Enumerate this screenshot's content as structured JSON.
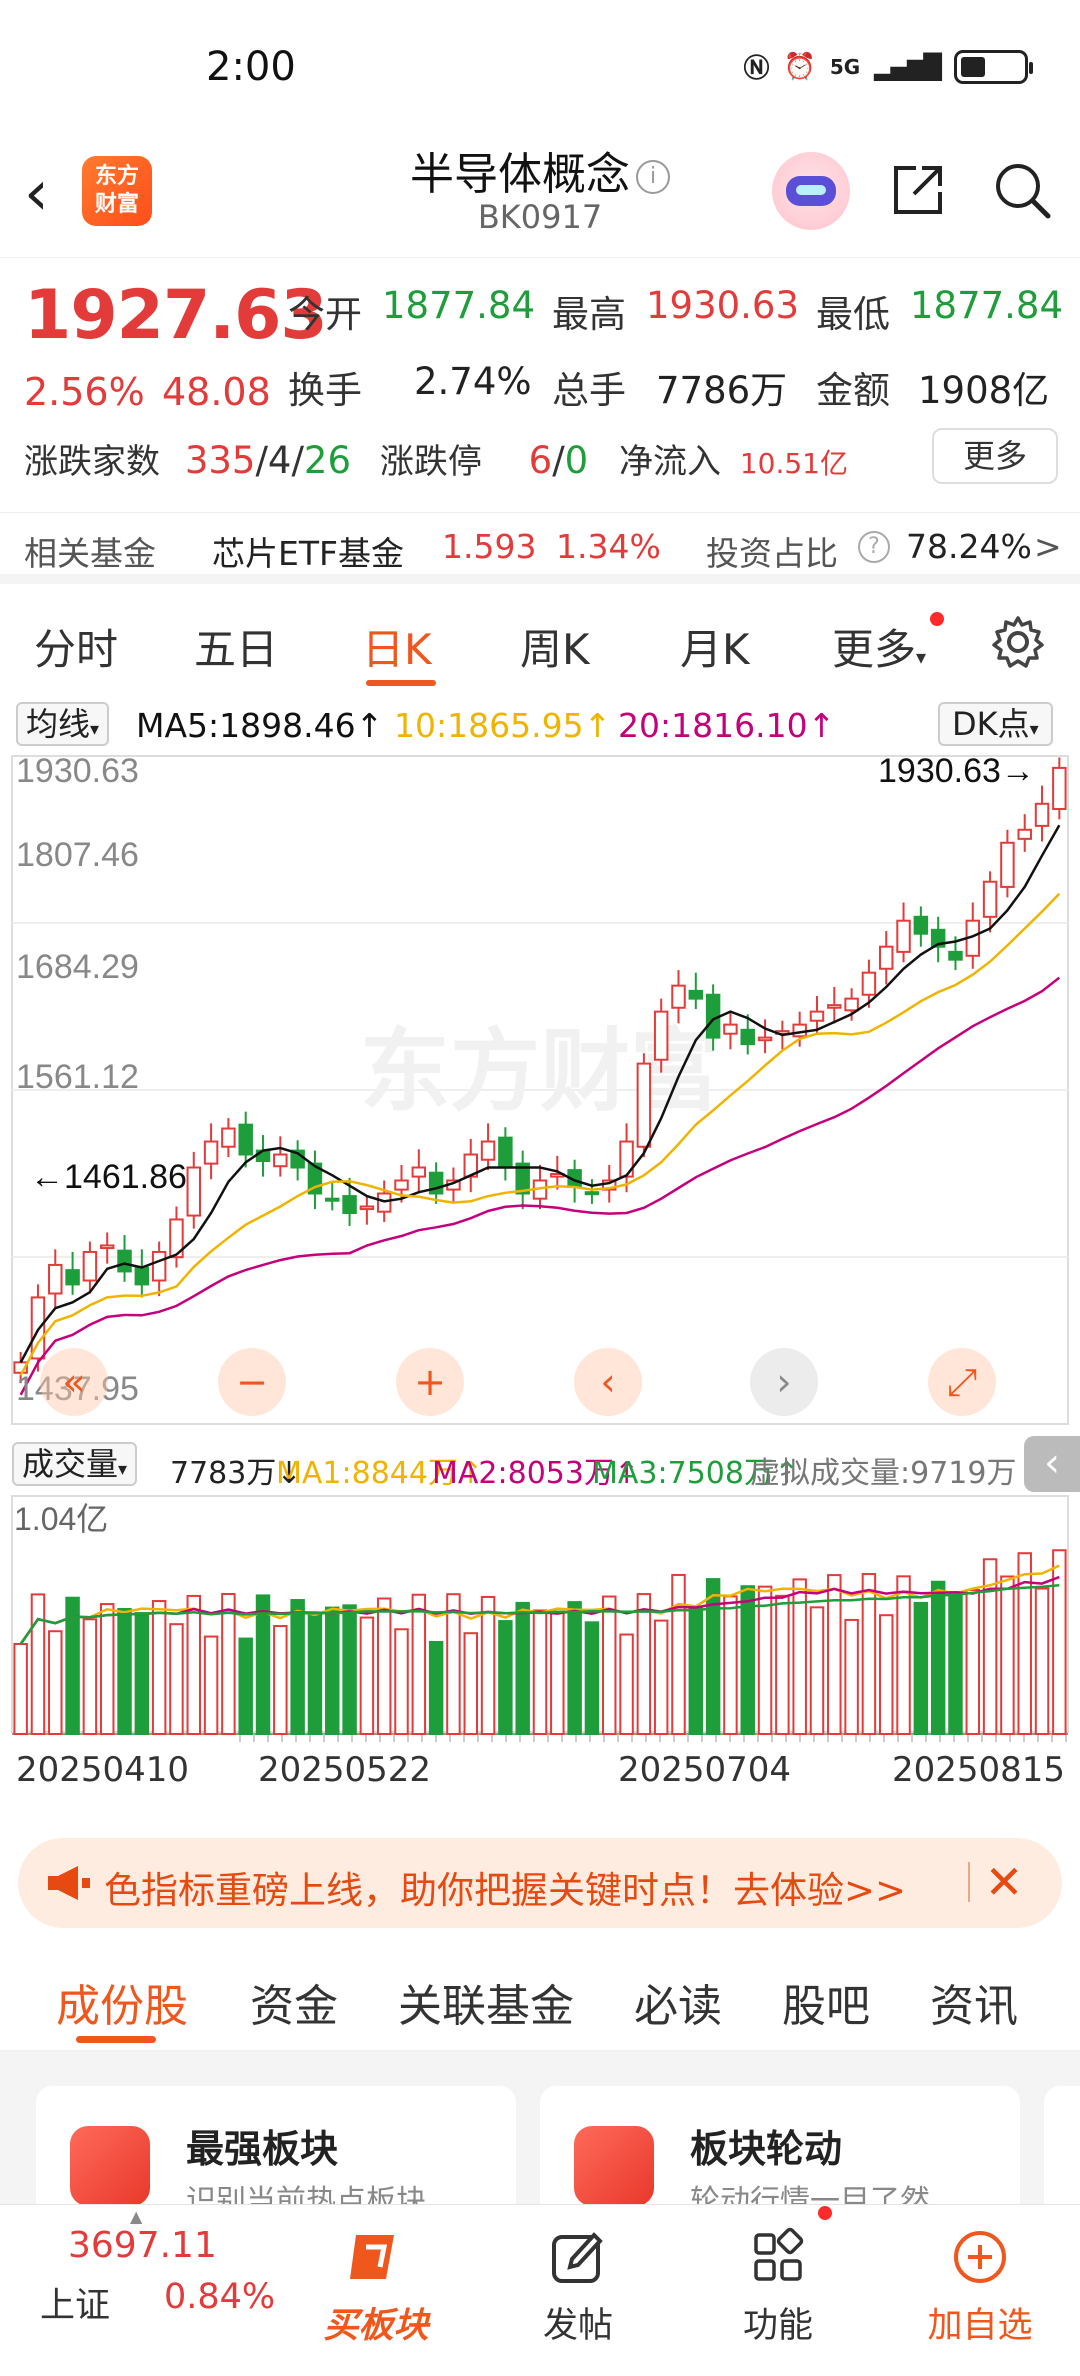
{
  "status_bar": {
    "time": "2:00",
    "net": "5G"
  },
  "header": {
    "logo_line1": "东方",
    "logo_line2": "财富",
    "title": "半导体概念",
    "code": "BK0917",
    "info_icon": "i"
  },
  "quote": {
    "price": "1927.63",
    "change_pct": "2.56%",
    "change_amt": "48.08",
    "open_label": "今开",
    "open": "1877.84",
    "high_label": "最高",
    "high": "1930.63",
    "low_label": "最低",
    "low": "1877.84",
    "turnover_label": "换手",
    "turnover": "2.74%",
    "volume_label": "总手",
    "volume": "7786万",
    "amount_label": "金额",
    "amount": "1908亿",
    "breadth_label": "涨跌家数",
    "breadth_up": "335",
    "breadth_sep1": "/",
    "breadth_flat": "4",
    "breadth_sep2": "/",
    "breadth_down": "26",
    "limit_label": "涨跌停",
    "limit_up": "6",
    "limit_sep": "/",
    "limit_down": "0",
    "inflow_label": "净流入",
    "inflow": "10.51亿",
    "more": "更多"
  },
  "fund": {
    "label": "相关基金",
    "name": "芯片ETF基金",
    "price": "1.593",
    "pct": "1.34%",
    "ratio_label": "投资占比",
    "ratio": "78.24%",
    "arrow": ">"
  },
  "period_tabs": [
    "分时",
    "五日",
    "日K",
    "周K",
    "月K",
    "更多"
  ],
  "ma": {
    "select": "均线",
    "ma5": "MA5:1898.46↑",
    "ma10": "10:1865.95↑",
    "ma20": "20:1816.10↑",
    "dk": "DK点"
  },
  "kline_axis": {
    "labels": [
      "1930.63",
      "1807.46",
      "1684.29",
      "1561.12",
      "1437.95"
    ],
    "max_marker": "1930.63",
    "min_marker": "1461.86"
  },
  "volume_row": {
    "select": "成交量",
    "value": "7783万↓",
    "ma1": "MA1:8844万↑",
    "ma2": "MA2:8053万↑",
    "ma3": "MA3:7508万↑",
    "virtual": "虚拟成交量:9719万",
    "axis_max": "1.04亿"
  },
  "dates": [
    "20250410",
    "20250522",
    "20250704",
    "20250815"
  ],
  "banner": {
    "text": "色指标重磅上线，助你把握关键时点！去体验>>",
    "close": "✕"
  },
  "content_tabs": [
    "成份股",
    "资金",
    "关联基金",
    "必读",
    "股吧",
    "资讯"
  ],
  "cards": [
    {
      "title": "最强板块",
      "subtitle": "识别当前热点板块"
    },
    {
      "title": "板块轮动",
      "subtitle": "轮动行情一目了然"
    }
  ],
  "bottom_nav": {
    "index_value": "3697.11",
    "index_name": "上证",
    "index_pct": "0.84%",
    "items": [
      "买板块",
      "发帖",
      "功能",
      "加自选"
    ]
  },
  "colors": {
    "up": "#e33a3a",
    "down": "#1e9e3a",
    "accent": "#f0571d",
    "ma5": "#111111",
    "ma10": "#f0b400",
    "ma20": "#c4007c"
  },
  "chart_data": {
    "type": "candlestick",
    "ylim": [
      1437.95,
      1930.63
    ],
    "x_ticks": [
      "20250410",
      "20250522",
      "20250704",
      "20250815"
    ],
    "ohlc_close_approx": [
      1470,
      1520,
      1545,
      1530,
      1555,
      1560,
      1540,
      1530,
      1555,
      1580,
      1620,
      1640,
      1650,
      1630,
      1625,
      1630,
      1620,
      1600,
      1595,
      1585,
      1590,
      1600,
      1610,
      1620,
      1600,
      1610,
      1630,
      1640,
      1620,
      1600,
      1610,
      1615,
      1605,
      1600,
      1610,
      1640,
      1700,
      1740,
      1760,
      1750,
      1720,
      1730,
      1715,
      1720,
      1725,
      1730,
      1740,
      1745,
      1750,
      1770,
      1790,
      1810,
      1800,
      1790,
      1780,
      1810,
      1840,
      1870,
      1880,
      1900,
      1927.63
    ],
    "ma5_last": 1898.46,
    "ma10_last": 1865.95,
    "ma20_last": 1816.1,
    "volume_max": "1.04亿",
    "volume_last": "7783万"
  }
}
